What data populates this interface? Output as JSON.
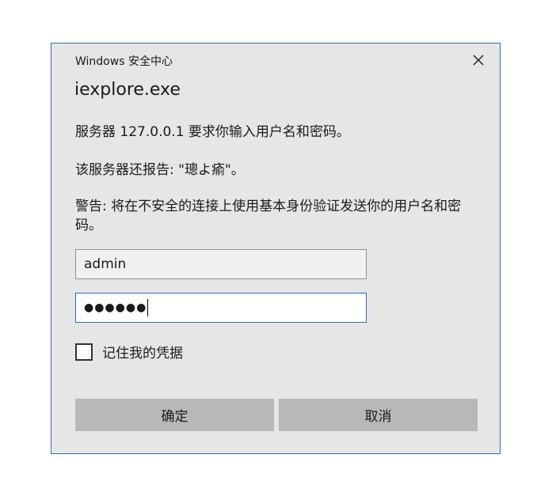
{
  "dialog": {
    "title": "Windows 安全中心",
    "app_name": "iexplore.exe",
    "message_server": "服务器 127.0.0.1 要求你输入用户名和密码。",
    "message_report": "该服务器还报告: \"璁よ瘉\"。",
    "message_warning": "警告: 将在不安全的连接上使用基本身份验证发送你的用户名和密码。",
    "username_value": "admin",
    "password_value": "●●●●●●",
    "remember_label": "记住我的凭据",
    "ok_label": "确定",
    "cancel_label": "取消",
    "icons": {
      "close": "close-icon"
    },
    "colors": {
      "background": "#e6e6e6",
      "border_accent": "#2b6cb0",
      "button": "#b8b8b8"
    }
  }
}
